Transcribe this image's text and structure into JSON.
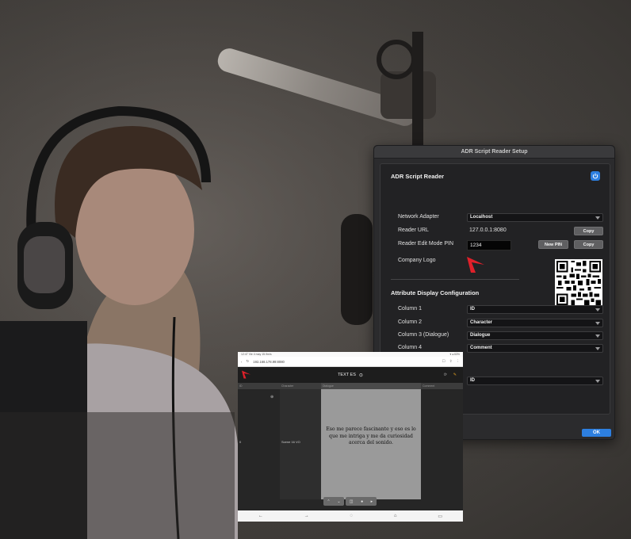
{
  "dialog": {
    "title": "ADR Script Reader Setup",
    "app_name": "ADR Script Reader",
    "network_adapter": {
      "label": "Network Adapter",
      "value": "Localhost"
    },
    "reader_url": {
      "label": "Reader URL",
      "value": "127.0.0.1:8080",
      "copy_label": "Copy"
    },
    "edit_pin": {
      "label": "Reader Edit Mode PIN",
      "value": "1234",
      "new_pin_label": "New PIN",
      "copy_label": "Copy"
    },
    "company_logo_label": "Company Logo",
    "attr_section_title": "Attribute Display Configuration",
    "columns": [
      {
        "label": "Column 1",
        "value": "ID"
      },
      {
        "label": "Column 2",
        "value": "Character"
      },
      {
        "label": "Column 3 (Dialogue)",
        "value": "Dialogue"
      },
      {
        "label": "Column 4",
        "value": "Comment"
      }
    ],
    "extra_select_value": "ID",
    "ok_label": "OK",
    "accent_color": "#2d7fe0",
    "logo_color": "#e0202a"
  },
  "tablet": {
    "status_left": "12:47  Vie 4 may  15.9m/s",
    "status_right": "▾ ◂ 63%",
    "url": "192.168.178.99:8080",
    "app_title": "TEXT ES",
    "col_headers": [
      "ID",
      "Character",
      "Dialogue",
      "Comment"
    ],
    "row_id": "0",
    "row_character": "Scene 16 VO",
    "dialogue": "Eso me parece fascinante y eso es lo que me intriga y me da curiosidad acerca del sonido."
  }
}
